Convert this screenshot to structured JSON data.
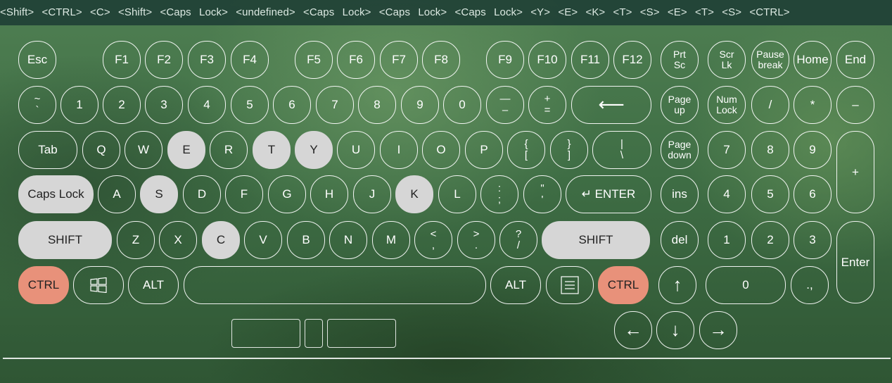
{
  "log": {
    "line1": "<Shift>  <CTRL>  <C>  <Shift>  <Caps Lock>  <undefined>  <Caps Lock>  <Caps Lock>  <Caps Lock>  <Y>  <E>  <K>  <T>  <S>  <E>  <T>  <S>  <CTRL>",
    "line2": ""
  },
  "keys": [
    {
      "id": "esc",
      "label": "Esc",
      "state": "normal"
    },
    {
      "id": "f1",
      "label": "F1",
      "state": "normal"
    },
    {
      "id": "f2",
      "label": "F2",
      "state": "normal"
    },
    {
      "id": "f3",
      "label": "F3",
      "state": "normal"
    },
    {
      "id": "f4",
      "label": "F4",
      "state": "normal"
    },
    {
      "id": "f5",
      "label": "F5",
      "state": "normal"
    },
    {
      "id": "f6",
      "label": "F6",
      "state": "normal"
    },
    {
      "id": "f7",
      "label": "F7",
      "state": "normal"
    },
    {
      "id": "f8",
      "label": "F8",
      "state": "normal"
    },
    {
      "id": "f9",
      "label": "F9",
      "state": "normal"
    },
    {
      "id": "f10",
      "label": "F10",
      "state": "normal"
    },
    {
      "id": "f11",
      "label": "F11",
      "state": "normal"
    },
    {
      "id": "f12",
      "label": "F12",
      "state": "normal"
    },
    {
      "id": "prtsc",
      "label": "Prt\nSc",
      "state": "normal"
    },
    {
      "id": "scrlk",
      "label": "Scr\nLk",
      "state": "normal"
    },
    {
      "id": "pause",
      "label": "Pause\nbreak",
      "state": "normal"
    },
    {
      "id": "home",
      "label": "Home",
      "state": "normal"
    },
    {
      "id": "end",
      "label": "End",
      "state": "normal"
    },
    {
      "id": "tilde",
      "label": "~\n`",
      "state": "normal"
    },
    {
      "id": "d1",
      "label": "1",
      "state": "normal"
    },
    {
      "id": "d2",
      "label": "2",
      "state": "normal"
    },
    {
      "id": "d3",
      "label": "3",
      "state": "normal"
    },
    {
      "id": "d4",
      "label": "4",
      "state": "normal"
    },
    {
      "id": "d5",
      "label": "5",
      "state": "normal"
    },
    {
      "id": "d6",
      "label": "6",
      "state": "normal"
    },
    {
      "id": "d7",
      "label": "7",
      "state": "normal"
    },
    {
      "id": "d8",
      "label": "8",
      "state": "normal"
    },
    {
      "id": "d9",
      "label": "9",
      "state": "normal"
    },
    {
      "id": "d0",
      "label": "0",
      "state": "normal"
    },
    {
      "id": "minus",
      "label": "—\n–",
      "state": "normal"
    },
    {
      "id": "equal",
      "label": "+\n=",
      "state": "normal"
    },
    {
      "id": "backspace",
      "label": "⟵",
      "state": "normal"
    },
    {
      "id": "pageup",
      "label": "Page\nup",
      "state": "normal"
    },
    {
      "id": "numlock",
      "label": "Num\nLock",
      "state": "normal"
    },
    {
      "id": "npdiv",
      "label": "/",
      "state": "normal"
    },
    {
      "id": "npmul",
      "label": "*",
      "state": "normal"
    },
    {
      "id": "npminus",
      "label": "–",
      "state": "normal"
    },
    {
      "id": "tab",
      "label": "Tab",
      "state": "normal"
    },
    {
      "id": "q",
      "label": "Q",
      "state": "normal"
    },
    {
      "id": "w",
      "label": "W",
      "state": "normal"
    },
    {
      "id": "e",
      "label": "E",
      "state": "pressed"
    },
    {
      "id": "r",
      "label": "R",
      "state": "normal"
    },
    {
      "id": "t",
      "label": "T",
      "state": "pressed"
    },
    {
      "id": "y",
      "label": "Y",
      "state": "pressed"
    },
    {
      "id": "u",
      "label": "U",
      "state": "normal"
    },
    {
      "id": "i",
      "label": "I",
      "state": "normal"
    },
    {
      "id": "o",
      "label": "O",
      "state": "normal"
    },
    {
      "id": "p",
      "label": "P",
      "state": "normal"
    },
    {
      "id": "lbrace",
      "label": "{\n[",
      "state": "normal"
    },
    {
      "id": "rbrace",
      "label": "}\n]",
      "state": "normal"
    },
    {
      "id": "pipe",
      "label": "|\n\\",
      "state": "normal"
    },
    {
      "id": "pagedown",
      "label": "Page\ndown",
      "state": "normal"
    },
    {
      "id": "np7",
      "label": "7",
      "state": "normal"
    },
    {
      "id": "np8",
      "label": "8",
      "state": "normal"
    },
    {
      "id": "np9",
      "label": "9",
      "state": "normal"
    },
    {
      "id": "npplus",
      "label": "+",
      "state": "normal"
    },
    {
      "id": "capslock",
      "label": "Caps Lock",
      "state": "pressed"
    },
    {
      "id": "a",
      "label": "A",
      "state": "normal"
    },
    {
      "id": "s",
      "label": "S",
      "state": "pressed"
    },
    {
      "id": "d",
      "label": "D",
      "state": "normal"
    },
    {
      "id": "f",
      "label": "F",
      "state": "normal"
    },
    {
      "id": "g",
      "label": "G",
      "state": "normal"
    },
    {
      "id": "h",
      "label": "H",
      "state": "normal"
    },
    {
      "id": "j",
      "label": "J",
      "state": "normal"
    },
    {
      "id": "k",
      "label": "K",
      "state": "pressed"
    },
    {
      "id": "l",
      "label": "L",
      "state": "normal"
    },
    {
      "id": "semicolon",
      "label": ":\n;",
      "state": "normal"
    },
    {
      "id": "quote",
      "label": "\"\n'",
      "state": "normal"
    },
    {
      "id": "enter",
      "label": "↵ ENTER",
      "state": "normal"
    },
    {
      "id": "ins",
      "label": "ins",
      "state": "normal"
    },
    {
      "id": "np4",
      "label": "4",
      "state": "normal"
    },
    {
      "id": "np5",
      "label": "5",
      "state": "normal"
    },
    {
      "id": "np6",
      "label": "6",
      "state": "normal"
    },
    {
      "id": "lshift",
      "label": "SHIFT",
      "state": "pressed"
    },
    {
      "id": "z",
      "label": "Z",
      "state": "normal"
    },
    {
      "id": "x",
      "label": "X",
      "state": "normal"
    },
    {
      "id": "c",
      "label": "C",
      "state": "pressed"
    },
    {
      "id": "v",
      "label": "V",
      "state": "normal"
    },
    {
      "id": "b",
      "label": "B",
      "state": "normal"
    },
    {
      "id": "n",
      "label": "N",
      "state": "normal"
    },
    {
      "id": "m",
      "label": "M",
      "state": "normal"
    },
    {
      "id": "comma",
      "label": "<\n,",
      "state": "normal"
    },
    {
      "id": "period",
      "label": ">\n.",
      "state": "normal"
    },
    {
      "id": "slash",
      "label": "?\n/",
      "state": "normal"
    },
    {
      "id": "rshift",
      "label": "SHIFT",
      "state": "pressed"
    },
    {
      "id": "del",
      "label": "del",
      "state": "normal"
    },
    {
      "id": "np1",
      "label": "1",
      "state": "normal"
    },
    {
      "id": "np2",
      "label": "2",
      "state": "normal"
    },
    {
      "id": "np3",
      "label": "3",
      "state": "normal"
    },
    {
      "id": "npenter",
      "label": "Enter",
      "state": "normal"
    },
    {
      "id": "lctrl",
      "label": "CTRL",
      "state": "accent"
    },
    {
      "id": "win",
      "label": "",
      "icon": "windows-icon",
      "state": "normal"
    },
    {
      "id": "lalt",
      "label": "ALT",
      "state": "normal"
    },
    {
      "id": "space",
      "label": "",
      "state": "normal"
    },
    {
      "id": "ralt",
      "label": "ALT",
      "state": "normal"
    },
    {
      "id": "menu",
      "label": "",
      "icon": "menu-icon",
      "state": "normal"
    },
    {
      "id": "rctrl",
      "label": "CTRL",
      "state": "accent"
    },
    {
      "id": "up",
      "label": "↑",
      "state": "normal"
    },
    {
      "id": "np0",
      "label": "0",
      "state": "normal"
    },
    {
      "id": "npdot",
      "label": ".,",
      "state": "normal"
    },
    {
      "id": "left",
      "label": "←",
      "state": "normal"
    },
    {
      "id": "down",
      "label": "↓",
      "state": "normal"
    },
    {
      "id": "right",
      "label": "→",
      "state": "normal"
    }
  ],
  "colors": {
    "pressed": "#d6d6d6",
    "accent": "#e8917a",
    "border": "#ffffff"
  }
}
